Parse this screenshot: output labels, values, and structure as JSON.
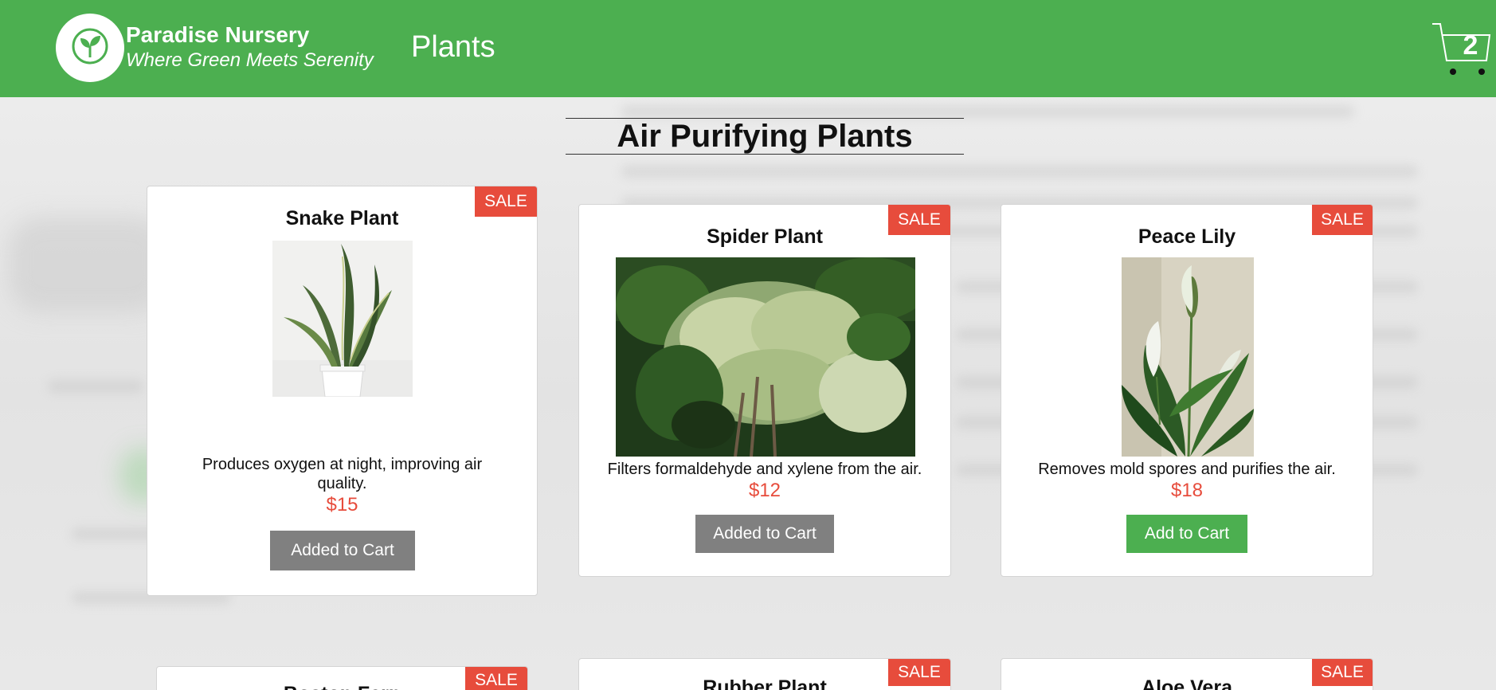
{
  "header": {
    "brand_name": "Paradise Nursery",
    "brand_tagline": "Where Green Meets Serenity",
    "nav_plants": "Plants",
    "cart_count": "2",
    "logo_icon": "sprout-icon",
    "cart_icon": "cart-icon"
  },
  "section": {
    "title": "Air Purifying Plants"
  },
  "plants": [
    {
      "name": "Snake Plant",
      "badge": "SALE",
      "description": "Produces oxygen at night, improving air quality.",
      "price": "$15",
      "button": "Added to Cart",
      "in_cart": true
    },
    {
      "name": "Spider Plant",
      "badge": "SALE",
      "description": "Filters formaldehyde and xylene from the air.",
      "price": "$12",
      "button": "Added to Cart",
      "in_cart": true
    },
    {
      "name": "Peace Lily",
      "badge": "SALE",
      "description": "Removes mold spores and purifies the air.",
      "price": "$18",
      "button": "Add to Cart",
      "in_cart": false
    },
    {
      "name": "Boston Fern",
      "badge": "SALE"
    },
    {
      "name": "Rubber Plant",
      "badge": "SALE"
    },
    {
      "name": "Aloe Vera",
      "badge": "SALE"
    }
  ],
  "colors": {
    "brand_green": "#4caf50",
    "sale_red": "#e74c3c",
    "added_gray": "#808080"
  }
}
